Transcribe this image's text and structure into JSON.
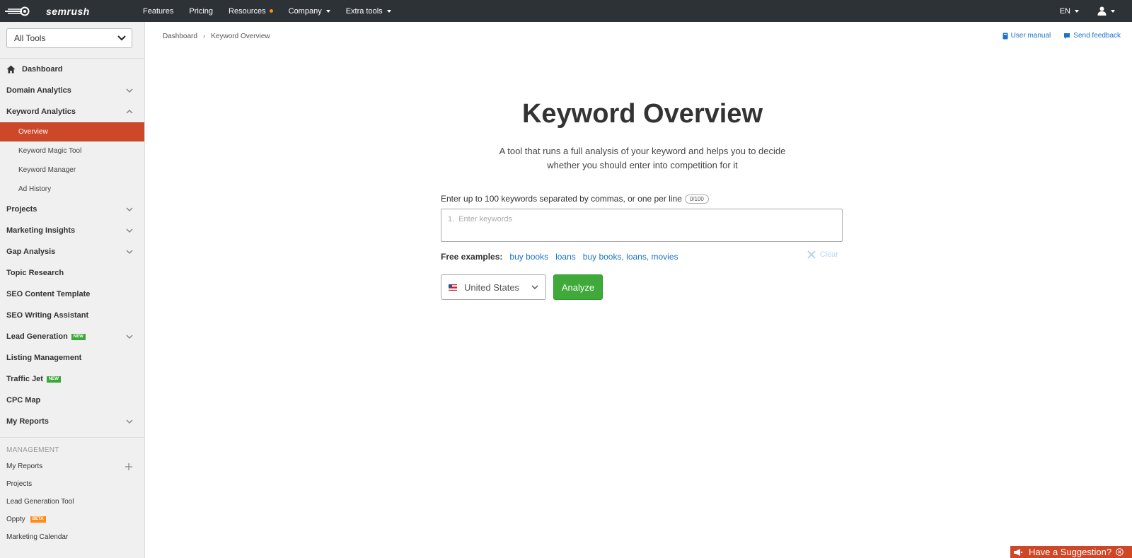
{
  "topbar": {
    "brand": "semrush",
    "nav": [
      {
        "label": "Features"
      },
      {
        "label": "Pricing"
      },
      {
        "label": "Resources"
      },
      {
        "label": "Company"
      },
      {
        "label": "Extra tools"
      }
    ],
    "language": "EN"
  },
  "sidebar": {
    "tools_select": "All Tools",
    "items": [
      {
        "label": "Dashboard"
      },
      {
        "label": "Domain Analytics"
      },
      {
        "label": "Keyword Analytics"
      },
      {
        "label": "Overview"
      },
      {
        "label": "Keyword Magic Tool"
      },
      {
        "label": "Keyword Manager"
      },
      {
        "label": "Ad History"
      },
      {
        "label": "Projects"
      },
      {
        "label": "Marketing Insights"
      },
      {
        "label": "Gap Analysis"
      },
      {
        "label": "Topic Research"
      },
      {
        "label": "SEO Content Template"
      },
      {
        "label": "SEO Writing Assistant"
      },
      {
        "label": "Lead Generation"
      },
      {
        "label": "Listing Management"
      },
      {
        "label": "Traffic Jet"
      },
      {
        "label": "CPC Map"
      },
      {
        "label": "My Reports"
      }
    ],
    "badges": {
      "new": "NEW",
      "beta": "BETA"
    },
    "management": {
      "heading": "MANAGEMENT",
      "items": [
        {
          "label": "My Reports"
        },
        {
          "label": "Projects"
        },
        {
          "label": "Lead Generation Tool"
        },
        {
          "label": "Oppty"
        },
        {
          "label": "Marketing Calendar"
        }
      ]
    }
  },
  "breadcrumb": {
    "root": "Dashboard",
    "current": "Keyword Overview"
  },
  "help": {
    "user_manual": "User manual",
    "send_feedback": "Send feedback"
  },
  "main": {
    "title": "Keyword Overview",
    "subtitle_line1": "A tool that runs a full analysis of your keyword and helps you to decide",
    "subtitle_line2": "whether you should enter into competition for it",
    "hint": "Enter up to 100 keywords separated by commas, or one per line",
    "counter": "0/100",
    "line_number": "1.",
    "keywords_placeholder": "Enter keywords",
    "free_examples_label": "Free examples:",
    "examples": [
      "buy books",
      "loans",
      "buy books, loans, movies"
    ],
    "clear_label": "Clear",
    "database": "United States",
    "analyze_label": "Analyze"
  },
  "suggestion": {
    "label": "Have a Suggestion?"
  },
  "colors": {
    "accent": "#cd4729",
    "topbar": "#2d3236",
    "link": "#1a73c8",
    "analyze": "#3fa93a"
  }
}
